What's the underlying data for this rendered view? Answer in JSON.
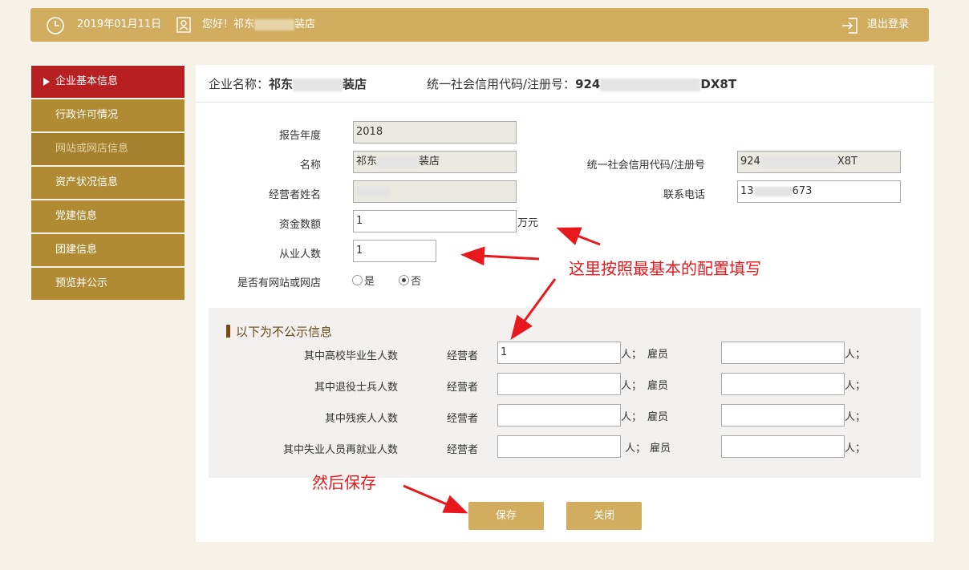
{
  "header": {
    "date": "2019年01月11日",
    "greeting_prefix": "您好！祁东",
    "greeting_suffix": "装店",
    "logout": "退出登录"
  },
  "sidebar": {
    "items": [
      {
        "label": "企业基本信息"
      },
      {
        "label": "行政许可情况"
      },
      {
        "label": "网站或网店信息"
      },
      {
        "label": "资产状况信息"
      },
      {
        "label": "党建信息"
      },
      {
        "label": "团建信息"
      },
      {
        "label": "预览并公示"
      }
    ]
  },
  "company": {
    "name_label": "企业名称：",
    "name_prefix": "祁东",
    "name_suffix": "装店",
    "code_label": "统一社会信用代码/注册号：",
    "code_prefix": "924",
    "code_suffix": "DX8T"
  },
  "form": {
    "report_year_label": "报告年度",
    "report_year": "2018",
    "name_label": "名称",
    "name_prefix": "祁东",
    "name_suffix": "装店",
    "code_label": "统一社会信用代码/注册号",
    "code_prefix": "924",
    "code_suffix": "X8T",
    "operator_label": "经营者姓名",
    "phone_label": "联系电话",
    "phone_prefix": "13",
    "phone_suffix": "673",
    "capital_label": "资金数额",
    "capital_value": "1",
    "capital_unit": "万元",
    "staff_label": "从业人数",
    "staff_value": "1",
    "website_label": "是否有网站或网店",
    "yes": "是",
    "no": "否"
  },
  "private": {
    "title": "以下为不公示信息",
    "operator": "经营者",
    "person_sep": "人；",
    "employee": "雇员",
    "person_end": "人；",
    "rows": [
      {
        "label": "其中高校毕业生人数",
        "operator_value": "1",
        "employee_value": ""
      },
      {
        "label": "其中退役士兵人数",
        "operator_value": "",
        "employee_value": ""
      },
      {
        "label": "其中残疾人人数",
        "operator_value": "",
        "employee_value": ""
      },
      {
        "label": "其中失业人员再就业人数",
        "operator_value": "",
        "employee_value": ""
      }
    ]
  },
  "buttons": {
    "save": "保存",
    "close": "关闭"
  },
  "annotations": {
    "config_note": "这里按照最基本的配置填写",
    "save_note": "然后保存"
  },
  "colors": {
    "gold": "#d2ad60",
    "sidebar": "#b18b33",
    "active": "#b71f20",
    "annotation": "#e8191d"
  }
}
